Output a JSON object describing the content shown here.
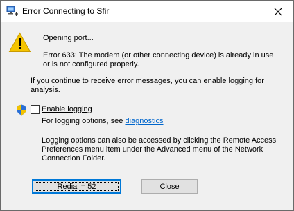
{
  "window": {
    "title": "Error Connecting to Sfir"
  },
  "message": {
    "opening": "Opening port...",
    "error_line1": "Error 633: The modem (or other connecting device) is already in use",
    "error_line2": "or is not configured properly.",
    "advice_line1": "If you continue to receive error messages, you can enable logging for",
    "advice_line2": "analysis."
  },
  "logging": {
    "checkbox_label": "Enable logging",
    "options_prefix": "For logging options, see ",
    "diagnostics_link": "diagnostics",
    "access_line1": "Logging options can also be accessed by clicking the Remote Access",
    "access_line2": "Preferences menu item under the Advanced menu of the Network",
    "access_line3": "Connection Folder."
  },
  "buttons": {
    "redial": "Redial = 52",
    "close": "Close"
  },
  "icons": {
    "title": "network-connection-icon",
    "warning": "warning-icon",
    "shield": "uac-shield-icon",
    "close": "close-icon"
  },
  "colors": {
    "link": "#0066cc",
    "default_button_border": "#0078d7",
    "warning_yellow": "#f5c400"
  }
}
